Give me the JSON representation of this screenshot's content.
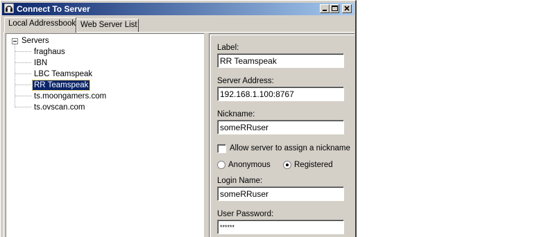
{
  "window": {
    "title": "Connect To Server"
  },
  "tabs": [
    {
      "label": "Local Addressbook",
      "active": true
    },
    {
      "label": "Web Server List",
      "active": false
    }
  ],
  "tree": {
    "root_label": "Servers",
    "items": [
      {
        "label": "fraghaus",
        "selected": false
      },
      {
        "label": "IBN",
        "selected": false
      },
      {
        "label": "LBC Teamspeak",
        "selected": false
      },
      {
        "label": "RR Teamspeak",
        "selected": true
      },
      {
        "label": "ts.moongamers.com",
        "selected": false
      },
      {
        "label": "ts.ovscan.com",
        "selected": false
      }
    ]
  },
  "form": {
    "label_caption": "Label:",
    "label_value": "RR Teamspeak",
    "address_caption": "Server Address:",
    "address_value": "192.168.1.100:8767",
    "nickname_caption": "Nickname:",
    "nickname_value": "someRRuser",
    "allow_nick_label": "Allow server to assign a nickname",
    "allow_nick_checked": false,
    "anonymous_label": "Anonymous",
    "registered_label": "Registered",
    "registered_selected": true,
    "login_caption": "Login Name:",
    "login_value": "someRRuser",
    "password_caption": "User Password:",
    "password_value": "******"
  },
  "colors": {
    "titlebar_start": "#0a246a",
    "titlebar_end": "#a6caf0",
    "window_face": "#d4d0c8",
    "selection": "#0a246a"
  }
}
